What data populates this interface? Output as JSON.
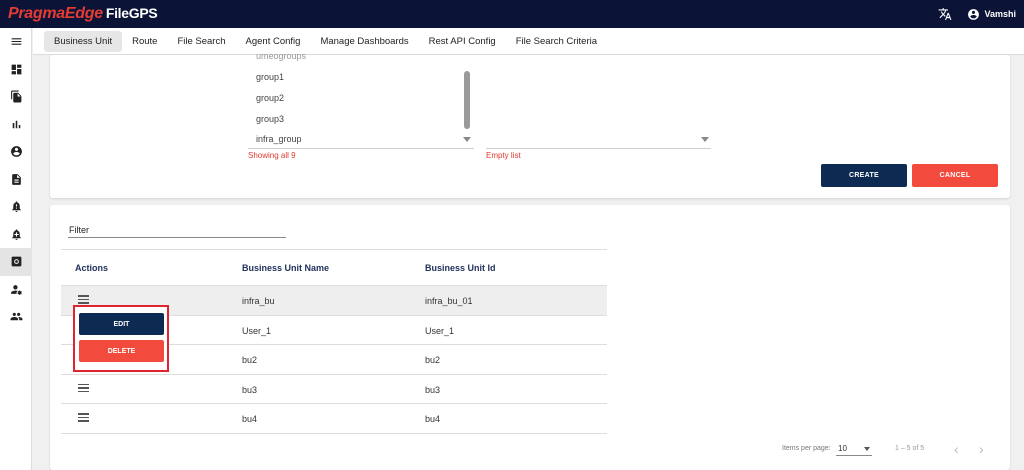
{
  "header": {
    "brand": "PragmaEdge",
    "product": "FileGPS",
    "translate_icon": "translate-icon",
    "user_name": "Vamshi",
    "colors": {
      "header_bg": "#0b1437",
      "brand_red": "#e53b33"
    }
  },
  "sidebar": {
    "items": [
      {
        "icon": "menu-icon"
      },
      {
        "icon": "dashboard-icon"
      },
      {
        "icon": "file-copy-icon"
      },
      {
        "icon": "bar-chart-icon"
      },
      {
        "icon": "account-circle-icon"
      },
      {
        "icon": "description-icon"
      },
      {
        "icon": "alert-bell-icon"
      },
      {
        "icon": "alert-add-icon"
      },
      {
        "icon": "settings-box-icon",
        "active": true
      },
      {
        "icon": "user-settings-icon"
      },
      {
        "icon": "group-icon"
      }
    ]
  },
  "tabs": [
    {
      "label": "Business Unit",
      "active": true
    },
    {
      "label": "Route"
    },
    {
      "label": "File Search"
    },
    {
      "label": "Agent Config"
    },
    {
      "label": "Manage Dashboards"
    },
    {
      "label": "Rest API Config"
    },
    {
      "label": "File Search Criteria"
    }
  ],
  "group_selector": {
    "available": [
      "umeogroups",
      "group1",
      "group2",
      "group3",
      "infra_group"
    ],
    "available_hint": "Showing all 9",
    "selected_hint": "Empty list"
  },
  "form_buttons": {
    "create": "CREATE",
    "cancel": "CANCEL"
  },
  "table": {
    "filter_label": "Filter",
    "columns": [
      "Actions",
      "Business Unit Name",
      "Business Unit Id"
    ],
    "rows": [
      {
        "name": "infra_bu",
        "id": "infra_bu_01"
      },
      {
        "name": "User_1",
        "id": "User_1"
      },
      {
        "name": "bu2",
        "id": "bu2"
      },
      {
        "name": "bu3",
        "id": "bu3"
      },
      {
        "name": "bu4",
        "id": "bu4"
      }
    ]
  },
  "row_menu": {
    "edit": "EDIT",
    "delete": "DELETE"
  },
  "paginator": {
    "items_per_page_label": "Items per page:",
    "page_size": "10",
    "range": "1 – 5 of 5",
    "prev_icon": "chevron-left-icon",
    "next_icon": "chevron-right-icon"
  }
}
